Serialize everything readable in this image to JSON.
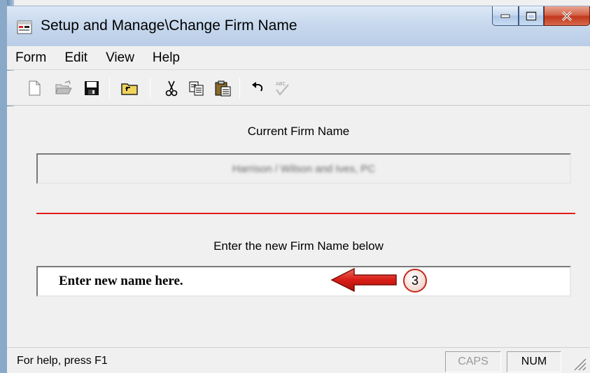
{
  "window": {
    "title": "Setup and Manage\\Change Firm Name"
  },
  "menu": {
    "items": [
      "Form",
      "Edit",
      "View",
      "Help"
    ]
  },
  "toolbar": {
    "icons": [
      "new-document-icon",
      "open-folder-icon",
      "save-disk-icon",
      "up-folder-icon",
      "cut-scissors-icon",
      "copy-icon",
      "paste-icon",
      "undo-icon",
      "spellcheck-icon"
    ]
  },
  "form": {
    "current_label": "Current Firm Name",
    "current_value": "Harrison / Wilson and Ives, PC",
    "new_label": "Enter the new Firm Name below",
    "new_value": "Enter new name here.",
    "divider_color": "#e31b1b"
  },
  "callout": {
    "number": "3",
    "color": "#d61f1f"
  },
  "statusbar": {
    "help_text": "For help, press F1",
    "caps": "CAPS",
    "num": "NUM"
  }
}
